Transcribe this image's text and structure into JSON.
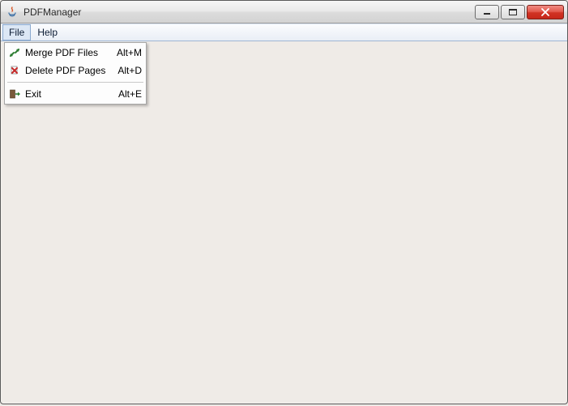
{
  "window": {
    "title": "PDFManager"
  },
  "menubar": {
    "file": "File",
    "help": "Help"
  },
  "dropdown": {
    "items": [
      {
        "label": "Merge PDF Files",
        "accel": "Alt+M"
      },
      {
        "label": "Delete PDF Pages",
        "accel": "Alt+D"
      },
      {
        "label": "Exit",
        "accel": "Alt+E"
      }
    ]
  }
}
